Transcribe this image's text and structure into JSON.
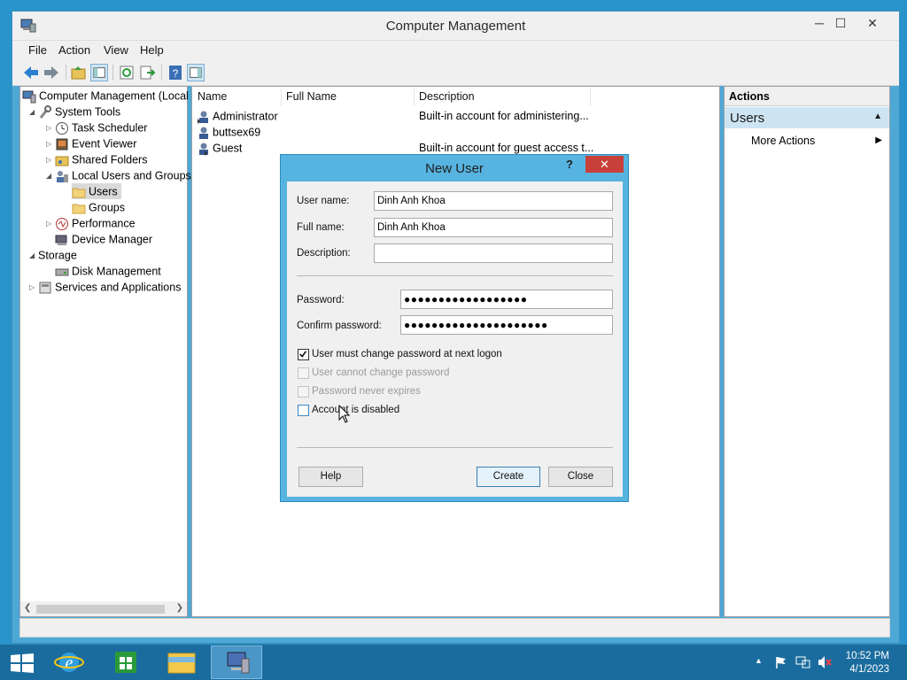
{
  "window": {
    "title": "Computer Management",
    "controls": {
      "minimize": "─",
      "maximize": "☐",
      "close": "✕"
    }
  },
  "menu": [
    "File",
    "Action",
    "View",
    "Help"
  ],
  "tree": {
    "root": "Computer Management (Local",
    "system_tools": "System Tools",
    "task_scheduler": "Task Scheduler",
    "event_viewer": "Event Viewer",
    "shared_folders": "Shared Folders",
    "local_users_groups": "Local Users and Groups",
    "users": "Users",
    "groups": "Groups",
    "performance": "Performance",
    "device_manager": "Device Manager",
    "storage": "Storage",
    "disk_management": "Disk Management",
    "services_apps": "Services and Applications"
  },
  "list": {
    "columns": [
      "Name",
      "Full Name",
      "Description"
    ],
    "rows": [
      {
        "name": "Administrator",
        "full_name": "",
        "description": "Built-in account for administering..."
      },
      {
        "name": "buttsex69",
        "full_name": "",
        "description": ""
      },
      {
        "name": "Guest",
        "full_name": "",
        "description": "Built-in account for guest access t..."
      }
    ]
  },
  "actions": {
    "header": "Actions",
    "section": "Users",
    "more": "More Actions"
  },
  "dialog": {
    "title": "New User",
    "help_glyph": "?",
    "close_glyph": "✕",
    "username_label": "User name:",
    "username_value": "Dinh Anh Khoa",
    "fullname_label": "Full name:",
    "fullname_value": "Dinh Anh Khoa",
    "description_label": "Description:",
    "description_value": "",
    "password_label": "Password:",
    "password_value": "●●●●●●●●●●●●●●●●●●",
    "confirm_label": "Confirm password:",
    "confirm_value": "●●●●●●●●●●●●●●●●●●●●●",
    "cb_must_change": "User must change password at next logon",
    "cb_cannot_change": "User cannot change password",
    "cb_never_expires": "Password never expires",
    "cb_disabled": "Account is disabled",
    "help_btn": "Help",
    "create_btn": "Create",
    "close_btn": "Close"
  },
  "taskbar": {
    "time": "10:52 PM",
    "date": "4/1/2023"
  },
  "colors": {
    "accent": "#57b3df",
    "close_red": "#c7403a",
    "taskbar": "#1a6c9e"
  }
}
